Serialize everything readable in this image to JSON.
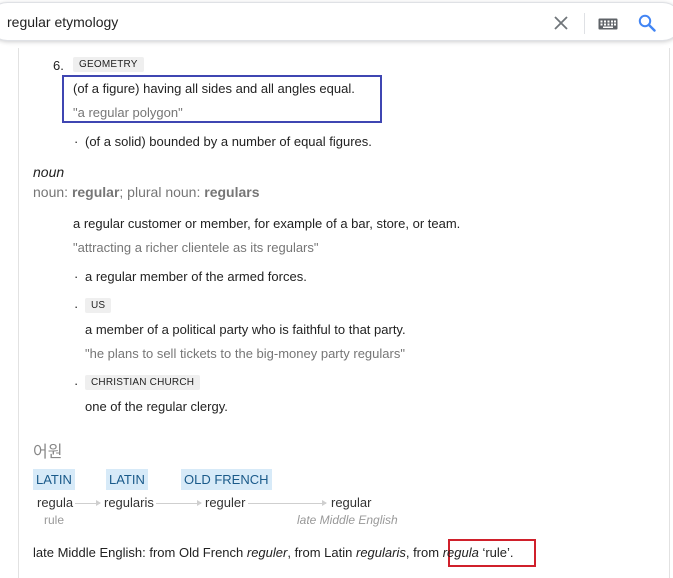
{
  "search": {
    "query": "regular etymology",
    "clear_icon": "close-icon",
    "keyboard_icon": "keyboard-icon",
    "search_icon": "search-icon",
    "accent": "#4285f4"
  },
  "sense6": {
    "number": "6.",
    "tag": "GEOMETRY",
    "definition": "(of a figure) having all sides and all angles equal.",
    "example": "\"a regular polygon\"",
    "sub_definition": "(of a solid) bounded by a number of equal figures."
  },
  "noun": {
    "pos": "noun",
    "forms_prefix": "noun: ",
    "singular": "regular",
    "forms_mid": "; plural noun: ",
    "plural": "regulars",
    "def1": "a regular customer or member, for example of a bar, store, or team.",
    "ex1": "\"attracting a richer clientele as its regulars\"",
    "def2": "a regular member of the armed forces.",
    "tag3": "US",
    "def3": "a member of a political party who is faithful to that party.",
    "ex3": "\"he plans to sell tickets to the big-money party regulars\"",
    "tag4": "CHRISTIAN CHURCH",
    "def4": "one of the regular clergy.",
    "bullet": "·"
  },
  "origin": {
    "heading": "어원",
    "langs": [
      "LATIN",
      "LATIN",
      "OLD FRENCH"
    ],
    "words": [
      "regula",
      "regularis",
      "reguler",
      "regular"
    ],
    "glosses": [
      "rule",
      "late Middle English"
    ],
    "text_1": "late Middle English: from Old French ",
    "w1": "reguler",
    "text_2": ", from Latin ",
    "w2": "regularis",
    "text_3": ", from ",
    "w3": "regula",
    "text_4": " ‘rule’."
  },
  "highlight_colors": {
    "blue_box": "#3f46b2",
    "red_box": "#d0202b"
  }
}
